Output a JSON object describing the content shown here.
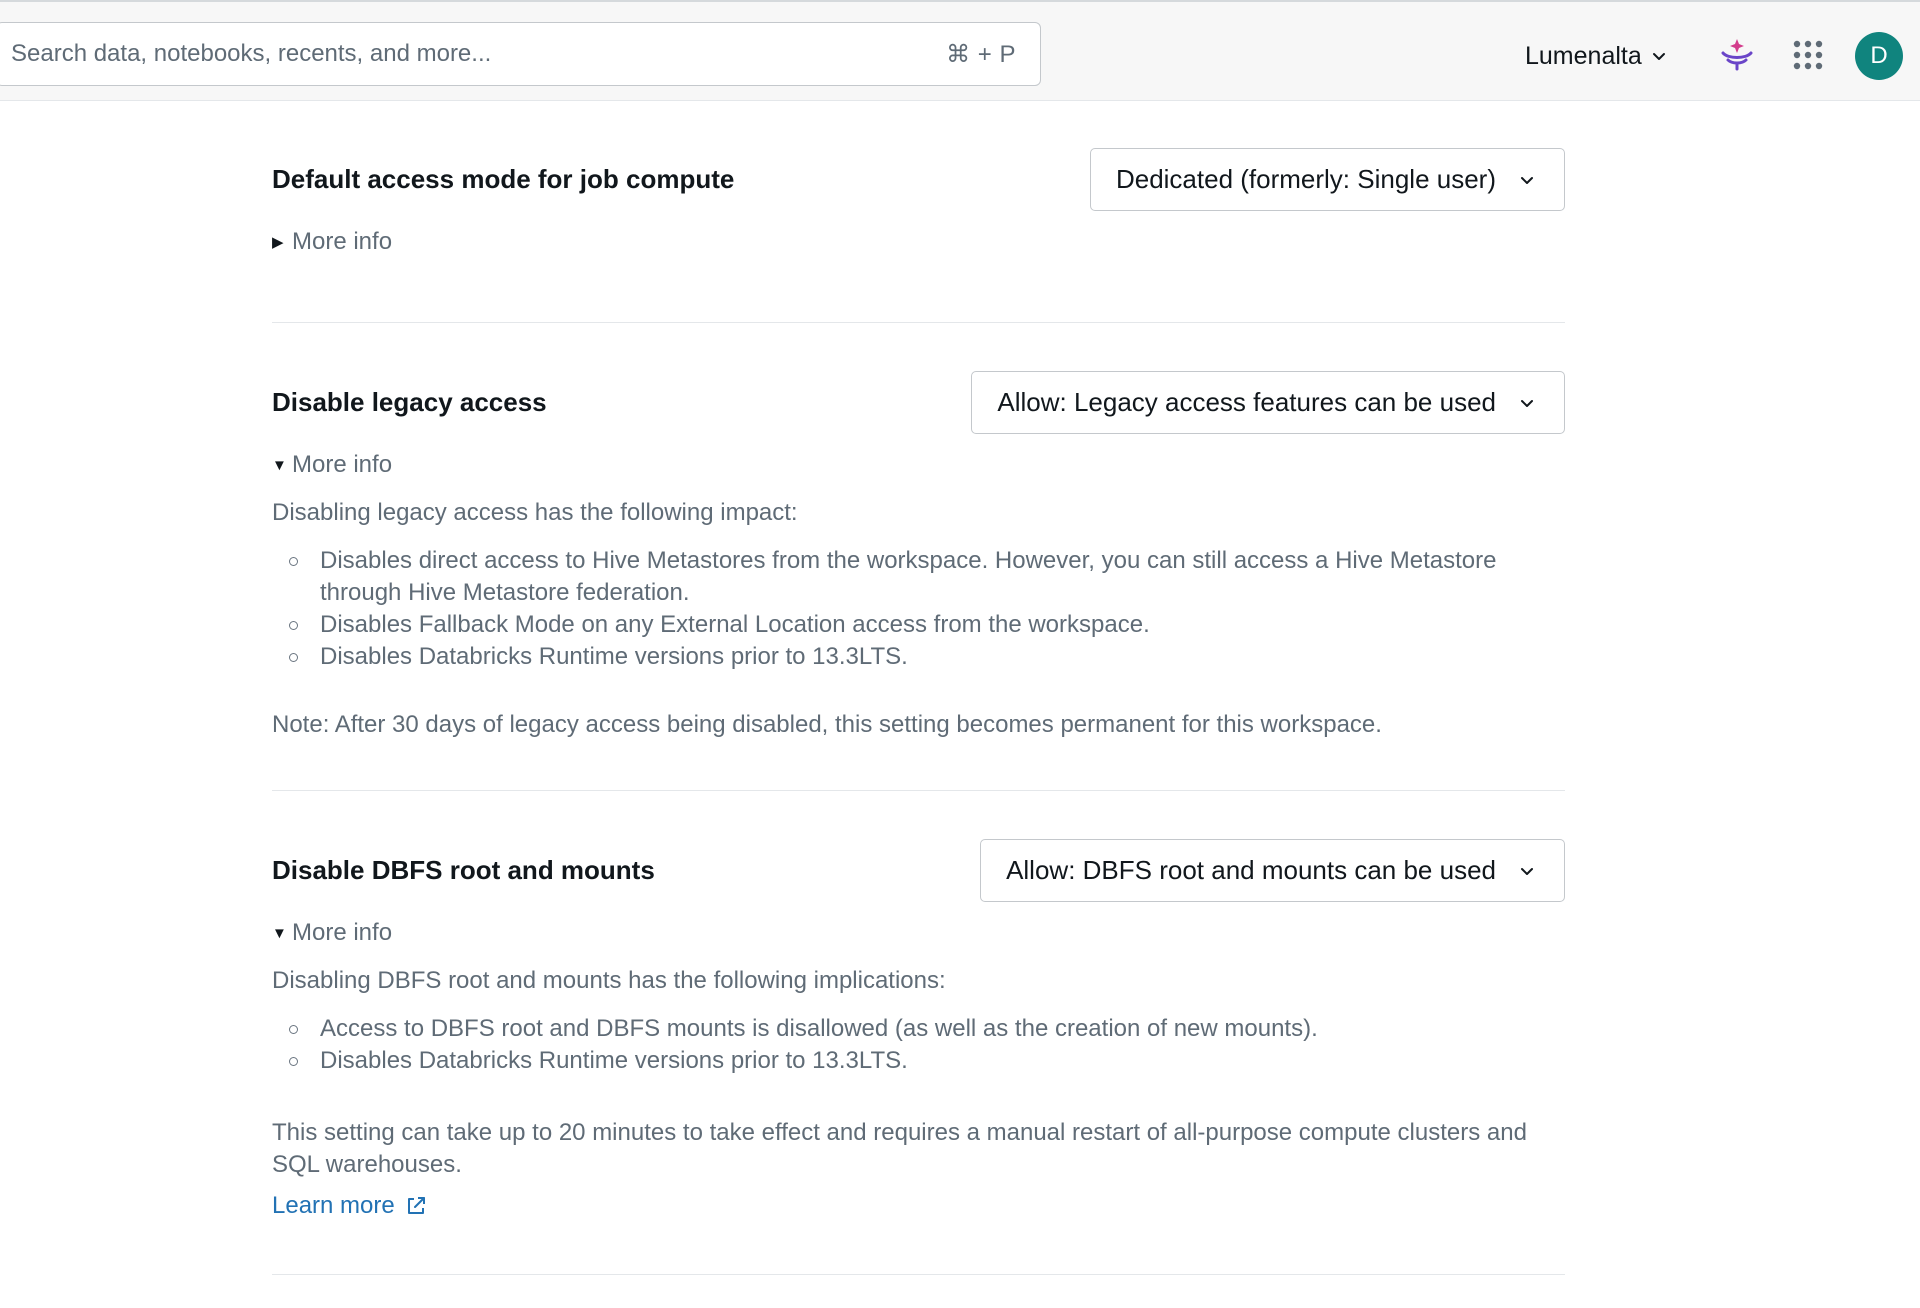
{
  "topbar": {
    "search_placeholder": "Search data, notebooks, recents, and more...",
    "search_shortcut": "⌘ + P",
    "workspace_name": "Lumenalta",
    "avatar_initial": "D",
    "avatar_color": "#10847e"
  },
  "settings": [
    {
      "title": "Default access mode for job compute",
      "selected": "Dedicated (formerly: Single user)",
      "more_info_label": "More info",
      "expanded": false
    },
    {
      "title": "Disable legacy access",
      "selected": "Allow: Legacy access features can be used",
      "more_info_label": "More info",
      "expanded": true,
      "intro": "Disabling legacy access has the following impact:",
      "bullets": [
        "Disables direct access to Hive Metastores from the workspace. However, you can still access a Hive Metastore through Hive Metastore federation.",
        "Disables Fallback Mode on any External Location access from the workspace.",
        "Disables Databricks Runtime versions prior to 13.3LTS."
      ],
      "note": "Note: After 30 days of legacy access being disabled, this setting becomes permanent for this workspace."
    },
    {
      "title": "Disable DBFS root and mounts",
      "selected": "Allow: DBFS root and mounts can be used",
      "more_info_label": "More info",
      "expanded": true,
      "intro": "Disabling DBFS root and mounts has the following implications:",
      "bullets": [
        "Access to DBFS root and DBFS mounts is disallowed (as well as the creation of new mounts).",
        "Disables Databricks Runtime versions prior to 13.3LTS."
      ],
      "note": "This setting can take up to 20 minutes to take effect and requires a manual restart of all-purpose compute clusters and SQL warehouses.",
      "learn_more_label": "Learn more"
    }
  ],
  "colors": {
    "link": "#2272b4",
    "secondary_text": "#5f6b76",
    "primary_text": "#11171c"
  }
}
